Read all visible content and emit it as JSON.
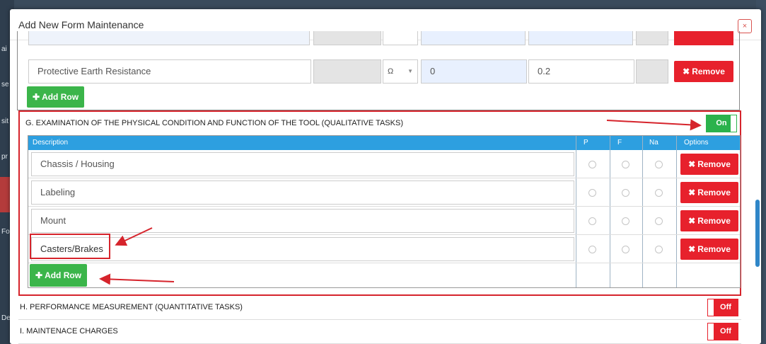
{
  "background": {
    "app_side_labels": [
      "ai",
      "se",
      "sit",
      "pr",
      "Fo",
      "De"
    ]
  },
  "modal": {
    "title": "Add New Form Maintenance",
    "close_glyph": "×"
  },
  "section_f": {
    "row": {
      "description": "Protective Earth Resistance",
      "unit": "Ω",
      "value_min": "0",
      "value_max": "0.2"
    },
    "remove_label": "Remove",
    "add_row_label": "Add Row"
  },
  "section_g": {
    "title": "G. EXAMINATION OF THE PHYSICAL CONDITION AND FUNCTION OF THE TOOL (QUALITATIVE TASKS)",
    "toggle_label": "On",
    "columns": [
      "Description",
      "P",
      "F",
      "Na",
      "Options"
    ],
    "rows": [
      {
        "description": "Chassis / Housing"
      },
      {
        "description": "Labeling"
      },
      {
        "description": "Mount"
      },
      {
        "description": "Casters/Brakes"
      }
    ],
    "remove_label": "Remove",
    "add_row_label": "Add Row"
  },
  "section_h": {
    "title": "H. PERFORMANCE MEASUREMENT (QUANTITATIVE TASKS)",
    "toggle_label": "Off"
  },
  "section_i": {
    "title": "I. MAINTENACE CHARGES",
    "toggle_label": "Off"
  },
  "colors": {
    "accent_blue": "#2d9fe0",
    "success_green": "#3bb54a",
    "danger_red": "#e7212c",
    "annotation_red": "#d6242c"
  }
}
